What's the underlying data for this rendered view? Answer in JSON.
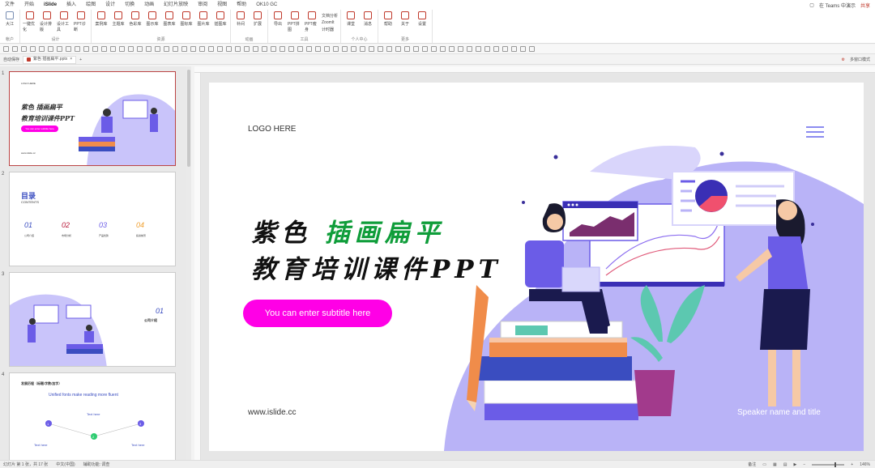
{
  "menubar": {
    "tabs": [
      "文件",
      "开始",
      "iSlide",
      "插入",
      "绘图",
      "设计",
      "切换",
      "动画",
      "幻灯片放映",
      "审阅",
      "视图",
      "帮助",
      "OK10 GC"
    ],
    "active_tab": "iSlide",
    "teams_label": "在 Teams 中演示",
    "share_label": "共享"
  },
  "ribbon": {
    "groups": [
      {
        "name": "帐户",
        "buttons": [
          "大江"
        ]
      },
      {
        "name": "设计",
        "buttons": [
          "一键优化",
          "设计排版",
          "设计工具",
          "PPT诊断"
        ]
      },
      {
        "name": "资源",
        "buttons": [
          "案例库",
          "主题库",
          "色彩库",
          "图示库",
          "图表库",
          "图标库",
          "图片库",
          "插图库"
        ]
      },
      {
        "name": "动画",
        "buttons": [
          "补间",
          "扩展"
        ]
      },
      {
        "name": "工具",
        "buttons": [
          "导出",
          "PPT拼图",
          "PPT瘦身"
        ],
        "small": [
          "文档分析",
          "ZoomIt",
          "计时器"
        ]
      },
      {
        "name": "个人中心",
        "buttons": [
          "课堂",
          "消息"
        ]
      },
      {
        "name": "更多",
        "buttons": [
          "帮助",
          "关于",
          "设置"
        ]
      }
    ]
  },
  "toolbar3": {
    "autosave": "自动保存",
    "doc_tab": "紫色 插画扁平.pptx",
    "right_label": "多窗口模式"
  },
  "thumbnails": {
    "numbers": [
      "1",
      "2",
      "3",
      "4"
    ],
    "t1": {
      "logo": "LOGO HERE",
      "line1": "紫色 插画扁平",
      "line2": "教育培训课件PPT",
      "btn": "You can enter subtitle here",
      "url": "www.islide.cc"
    },
    "t2": {
      "title": "目录",
      "sub": "CONTENTS",
      "items": [
        "01",
        "02",
        "03",
        "04"
      ],
      "labels": [
        "公司介绍",
        "市场分析",
        "产品优势",
        "投资前景"
      ]
    },
    "t3": {
      "num": "01",
      "label": "公司介绍"
    },
    "t4": {
      "title": "发展历程（标题/字数/加字）",
      "sub": "Unified fonts make reading more fluent",
      "text": "Text here",
      "text_items": [
        "Text here",
        "Text here"
      ],
      "nums": [
        "1",
        "2",
        "3"
      ]
    }
  },
  "slide": {
    "logo": "LOGO HERE",
    "title_black": "紫色",
    "title_green": "插画扁平",
    "title_line2": "教育培训课件PPT",
    "subtitle_button": "You can enter subtitle here",
    "url": "www.islide.cc",
    "speaker": "Speaker name and title"
  },
  "statusbar": {
    "left": "幻灯片 第 1 张，共 17 张",
    "lang": "中文(中国)",
    "access": "辅助功能: 调查",
    "notes": "备注",
    "zoom": "146%"
  },
  "colors": {
    "purple": "#6b5ce7",
    "light_purple": "#b9b3f7",
    "pink": "#ff00e6",
    "green": "#0f9d3a",
    "accent": "#c0392b"
  }
}
